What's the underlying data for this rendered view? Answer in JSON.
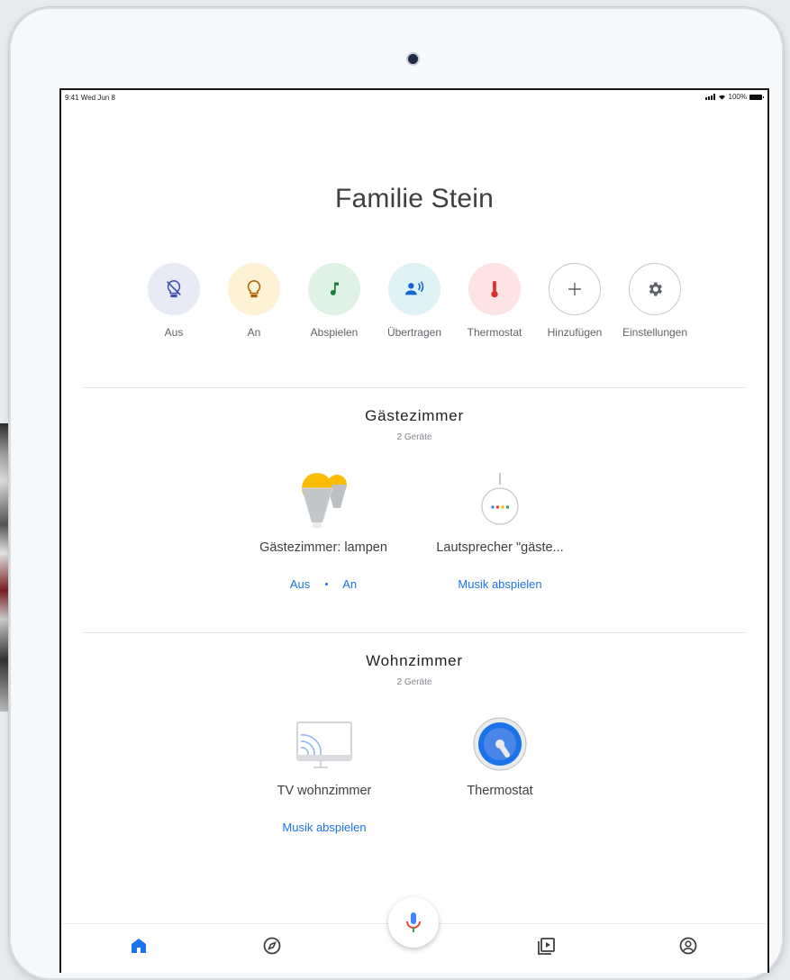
{
  "status_bar": {
    "time": "9:41  Wed Jun 8",
    "battery": "100%"
  },
  "home": {
    "title": "Familie Stein"
  },
  "actions": [
    {
      "label": "Aus",
      "icon": "light-off-icon",
      "bg": "#e8eaf6"
    },
    {
      "label": "An",
      "icon": "light-bulb-icon",
      "bg": "#fdf2d3"
    },
    {
      "label": "Abspielen",
      "icon": "music-note-icon",
      "bg": "#e0f2e6"
    },
    {
      "label": "Übertragen",
      "icon": "cast-person-icon",
      "bg": "#dff3f7"
    },
    {
      "label": "Thermostat",
      "icon": "thermometer-icon",
      "bg": "#fde3e3"
    },
    {
      "label": "Hinzufügen",
      "icon": "plus-icon",
      "bg": "#ffffff"
    },
    {
      "label": "Einstellungen",
      "icon": "gear-icon",
      "bg": "#ffffff"
    }
  ],
  "rooms": [
    {
      "title": "Gästezimmer",
      "subtitle": "2 Geräte",
      "devices": [
        {
          "name": "Gästezimmer: lampen",
          "icon": "lamps-icon",
          "actions": [
            "Aus",
            "An"
          ]
        },
        {
          "name": "Lautsprecher \"gäste...",
          "icon": "smart-speaker-icon",
          "actions": [
            "Musik abspielen"
          ]
        }
      ]
    },
    {
      "title": "Wohnzimmer",
      "subtitle": "2 Geräte",
      "devices": [
        {
          "name": "TV wohnzimmer",
          "icon": "cast-tv-icon",
          "actions": [
            "Musik abspielen"
          ]
        },
        {
          "name": "Thermostat",
          "icon": "thermostat-dial-icon",
          "actions": []
        }
      ]
    }
  ],
  "bottom_nav": [
    "home-icon",
    "explore-compass-icon",
    "media-play-icon",
    "account-icon"
  ],
  "colors": {
    "accent": "#1a73e8",
    "text": "#3c4043"
  }
}
